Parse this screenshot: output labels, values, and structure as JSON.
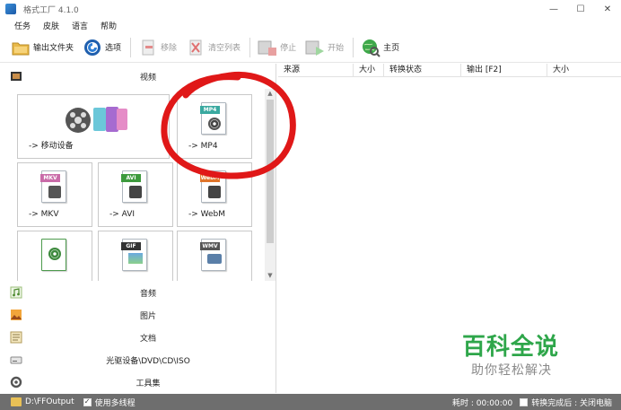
{
  "window": {
    "title": "格式工厂 4.1.0"
  },
  "menu": [
    "任务",
    "皮肤",
    "语言",
    "帮助"
  ],
  "toolbar": {
    "output_folder": "输出文件夹",
    "options": "选项",
    "remove": "移除",
    "clear_list": "清空列表",
    "stop": "停止",
    "start": "开始",
    "home": "主页"
  },
  "left": {
    "video_label": "视频",
    "tiles": [
      {
        "label": "-> 移动设备",
        "tag": ""
      },
      {
        "label": "-> MP4",
        "tag": "MP4"
      },
      {
        "label": "-> MKV",
        "tag": "MKV"
      },
      {
        "label": "-> AVI",
        "tag": "AVI"
      },
      {
        "label": "-> WebM",
        "tag": "WebM"
      },
      {
        "label": "",
        "tag": ""
      },
      {
        "label": "",
        "tag": "GIF"
      },
      {
        "label": "",
        "tag": "WMV"
      }
    ],
    "categories": [
      "音频",
      "图片",
      "文档",
      "光驱设备\\DVD\\CD\\ISO",
      "工具集"
    ]
  },
  "table": {
    "columns": [
      "来源",
      "大小",
      "转换状态",
      "输出 [F2]",
      "大小"
    ]
  },
  "status": {
    "path": "D:\\FFOutput",
    "multithread": "使用多线程",
    "elapsed": "耗时 : 00:00:00",
    "after_done": "转换完成后 : 关闭电脑"
  },
  "watermark": {
    "brand": "百科全说",
    "slogan": "助你轻松解决"
  },
  "colors": {
    "accent": "#2ea64a",
    "annotation": "#e01818",
    "statusbar": "#6e6e6e"
  }
}
